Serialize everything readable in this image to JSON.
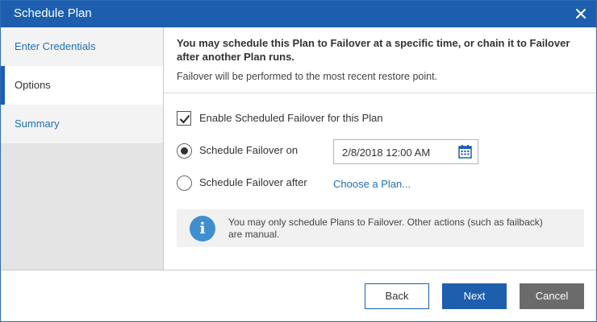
{
  "window": {
    "title": "Schedule Plan",
    "close_icon": "close-icon"
  },
  "sidebar": {
    "items": [
      {
        "label": "Enter Credentials",
        "active": false
      },
      {
        "label": "Options",
        "active": true
      },
      {
        "label": "Summary",
        "active": false
      }
    ]
  },
  "main": {
    "headline": "You may schedule this Plan to Failover at a specific time, or chain it to Failover after another Plan runs.",
    "subline": "Failover will be performed to the most recent restore point.",
    "enable_checkbox": {
      "label": "Enable Scheduled Failover for this Plan",
      "checked": true
    },
    "schedule_on": {
      "label": "Schedule Failover on",
      "selected": true,
      "date_value": "2/8/2018 12:00 AM",
      "icon": "calendar-icon"
    },
    "schedule_after": {
      "label": "Schedule Failover after",
      "selected": false,
      "link_label": "Choose a Plan..."
    },
    "info": {
      "icon": "info-icon",
      "text": "You may only schedule Plans to Failover. Other actions (such as failback) are manual."
    }
  },
  "footer": {
    "back_label": "Back",
    "next_label": "Next",
    "cancel_label": "Cancel"
  },
  "colors": {
    "titlebar": "#1d5fae",
    "accent_link": "#1f6fb5",
    "cancel_button": "#6b6b6b"
  }
}
